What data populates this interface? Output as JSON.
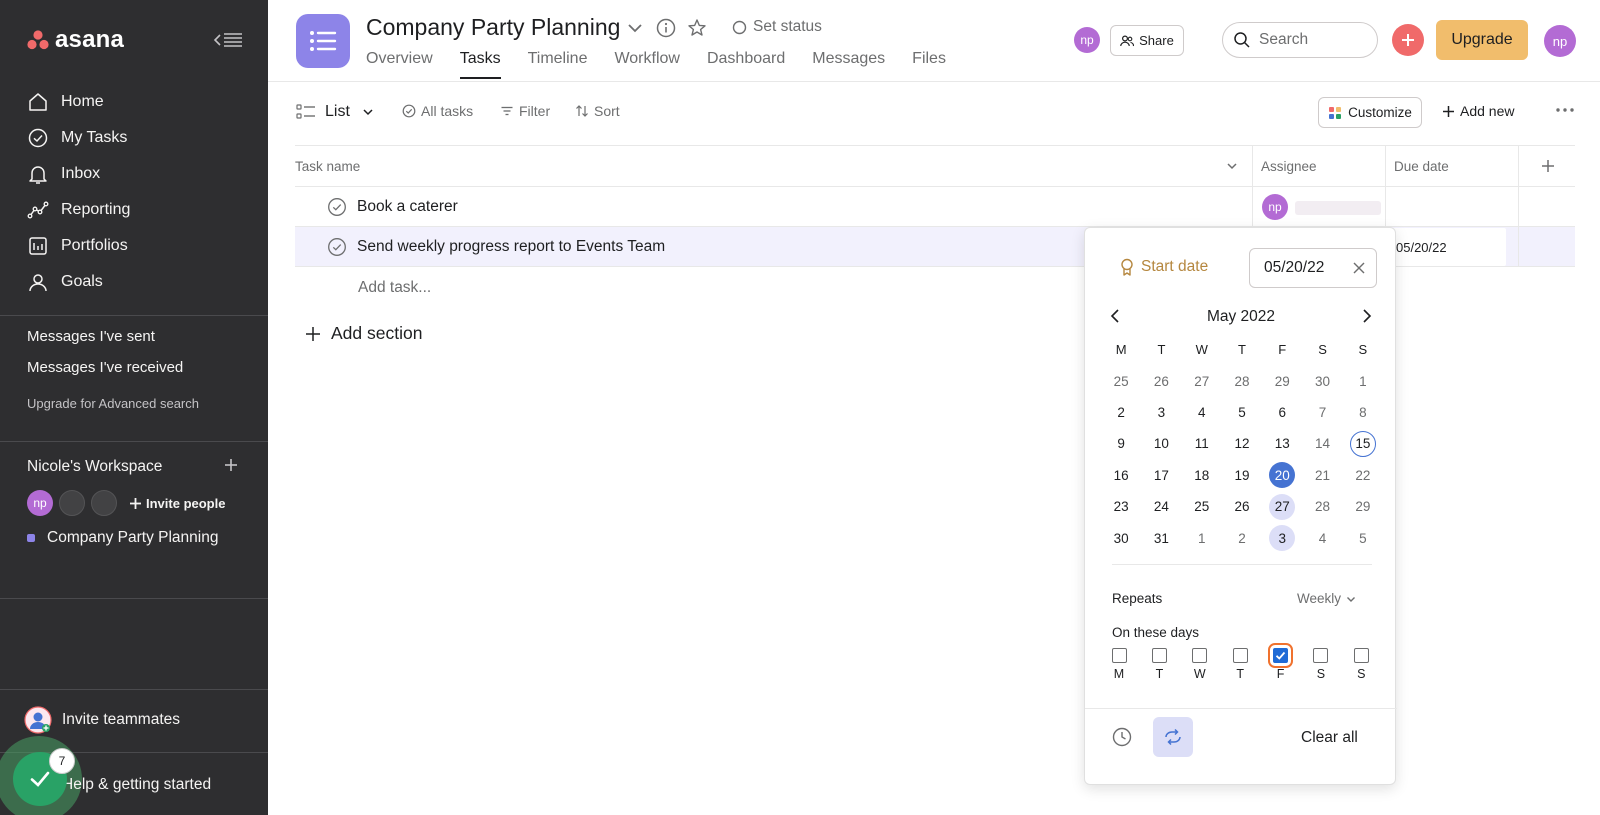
{
  "sidebar": {
    "logo": "asana",
    "nav": [
      {
        "label": "Home",
        "icon": "home-icon"
      },
      {
        "label": "My Tasks",
        "icon": "check-circle-icon"
      },
      {
        "label": "Inbox",
        "icon": "bell-icon"
      },
      {
        "label": "Reporting",
        "icon": "reporting-icon"
      },
      {
        "label": "Portfolios",
        "icon": "portfolio-icon"
      },
      {
        "label": "Goals",
        "icon": "goals-icon"
      }
    ],
    "messages_sent": "Messages I've sent",
    "messages_received": "Messages I've received",
    "upgrade_search": "Upgrade for Advanced search",
    "workspace": {
      "title": "Nicole's Workspace",
      "avatar_initials": "np",
      "invite_people": "Invite people",
      "project": "Company Party Planning"
    },
    "invite_teammates": "Invite teammates",
    "help": "Help & getting started",
    "help_badge": "7"
  },
  "header": {
    "title": "Company Party Planning",
    "set_status": "Set status",
    "tabs": [
      "Overview",
      "Tasks",
      "Timeline",
      "Workflow",
      "Dashboard",
      "Messages",
      "Files"
    ],
    "active_tab": "Tasks",
    "member_initials": "np",
    "share": "Share",
    "search_placeholder": "Search",
    "upgrade": "Upgrade",
    "user_initials": "np"
  },
  "toolbar": {
    "view": "List",
    "all_tasks": "All tasks",
    "filter": "Filter",
    "sort": "Sort",
    "customize": "Customize",
    "add_new": "Add new"
  },
  "table": {
    "columns": [
      "Task name",
      "Assignee",
      "Due date"
    ],
    "rows": [
      {
        "name": "Book a caterer",
        "assignee": "np",
        "due": ""
      },
      {
        "name": "Send weekly progress report to Events Team",
        "assignee": "",
        "due": "05/20/22"
      }
    ],
    "add_task": "Add task...",
    "add_section": "Add section"
  },
  "date_picker": {
    "start_date_label": "Start date",
    "date_value": "05/20/22",
    "month": "May 2022",
    "weekday_headers": [
      "M",
      "T",
      "W",
      "T",
      "F",
      "S",
      "S"
    ],
    "weeks": [
      [
        25,
        26,
        27,
        28,
        29,
        30,
        1
      ],
      [
        2,
        3,
        4,
        5,
        6,
        7,
        8
      ],
      [
        9,
        10,
        11,
        12,
        13,
        14,
        15
      ],
      [
        16,
        17,
        18,
        19,
        20,
        21,
        22
      ],
      [
        23,
        24,
        25,
        26,
        27,
        28,
        29
      ],
      [
        30,
        31,
        1,
        2,
        3,
        4,
        5
      ]
    ],
    "today": 15,
    "selected": 20,
    "repeat_days": [
      27,
      3
    ],
    "repeats_label": "Repeats",
    "repeats_value": "Weekly",
    "on_days_label": "On these days",
    "days": [
      {
        "letter": "M",
        "checked": false
      },
      {
        "letter": "T",
        "checked": false
      },
      {
        "letter": "W",
        "checked": false
      },
      {
        "letter": "T",
        "checked": false
      },
      {
        "letter": "F",
        "checked": true
      },
      {
        "letter": "S",
        "checked": false
      },
      {
        "letter": "S",
        "checked": false
      }
    ],
    "clear_all": "Clear all"
  },
  "colors": {
    "sidebar_bg": "#2e2e30",
    "project_purple": "#8d84e8",
    "avatar_purple": "#b36bd4",
    "upgrade_yellow": "#f1bd6c",
    "add_red": "#f06a6a",
    "selected_blue": "#4573d2",
    "help_green": "#29a266"
  }
}
